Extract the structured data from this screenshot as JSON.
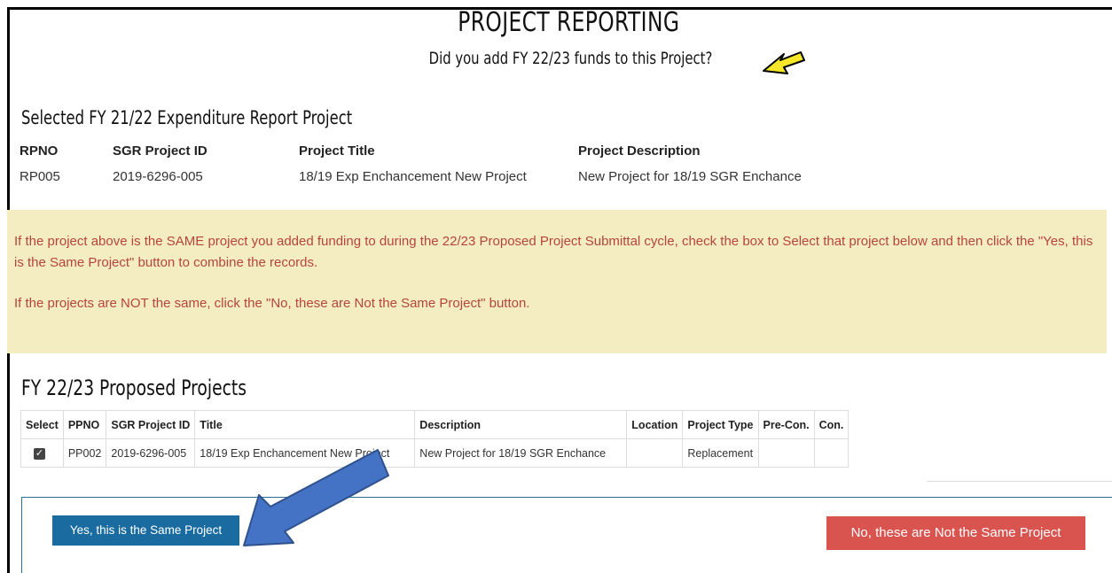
{
  "header": {
    "title": "PROJECT REPORTING",
    "subtitle": "Did you add FY 22/23 funds to this Project?"
  },
  "selected_project": {
    "heading": "Selected FY 21/22 Expenditure Report Project",
    "columns": [
      "RPNO",
      "SGR Project ID",
      "Project Title",
      "Project Description"
    ],
    "row": [
      "RP005",
      "2019-6296-005",
      "18/19 Exp Enchancement New Project",
      "New Project for 18/19 SGR Enchance"
    ]
  },
  "notice": {
    "line1": "If the project above is the SAME project you added funding to during the 22/23 Proposed Project Submittal cycle, check the box to Select that project below and then click the \"Yes, this is the Same Project\" button to combine the records.",
    "line2": "If the projects are NOT the same, click the \"No, these are Not the Same Project\" button.",
    "text_color": "#b5453b",
    "background": "#f5edc2"
  },
  "proposed_projects": {
    "heading": "FY 22/23 Proposed Projects",
    "columns": [
      "Select",
      "PPNO",
      "SGR Project ID",
      "Title",
      "Description",
      "Location",
      "Project Type",
      "Pre-Con.",
      "Con."
    ],
    "rows": [
      {
        "selected": true,
        "ppno": "PP002",
        "sgr_project_id": "2019-6296-005",
        "title": "18/19 Exp Enchancement New Project",
        "description": "New Project for 18/19 SGR Enchance",
        "location": "",
        "project_type": "Replacement",
        "pre_con": "",
        "con": ""
      }
    ]
  },
  "actions": {
    "yes_label": "Yes, this is the Same Project",
    "no_label": "No, these are Not the Same Project",
    "yes_color": "#1a6ca0",
    "no_color": "#d9534f"
  },
  "annotations": {
    "yellow_arrow_color": "#f5e62a",
    "blue_arrow_color": "#4472c4"
  }
}
